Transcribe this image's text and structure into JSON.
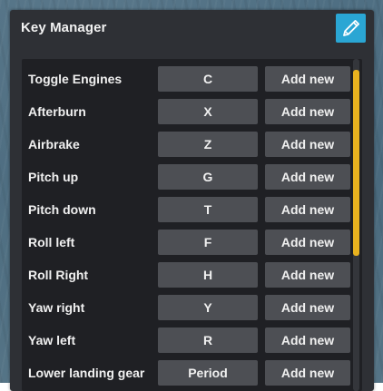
{
  "window": {
    "title": "Key Manager",
    "edit_icon": "pencil-icon",
    "accent_color": "#2aa6d4",
    "scrollbar_color": "#e8b21f"
  },
  "bindings": [
    {
      "action": "Toggle Engines",
      "key": "C",
      "add_label": "Add new"
    },
    {
      "action": "Afterburn",
      "key": "X",
      "add_label": "Add new"
    },
    {
      "action": "Airbrake",
      "key": "Z",
      "add_label": "Add new"
    },
    {
      "action": "Pitch up",
      "key": "G",
      "add_label": "Add new"
    },
    {
      "action": "Pitch down",
      "key": "T",
      "add_label": "Add new"
    },
    {
      "action": "Roll left",
      "key": "F",
      "add_label": "Add new"
    },
    {
      "action": "Roll Right",
      "key": "H",
      "add_label": "Add new"
    },
    {
      "action": "Yaw right",
      "key": "Y",
      "add_label": "Add new"
    },
    {
      "action": "Yaw left",
      "key": "R",
      "add_label": "Add new"
    },
    {
      "action": "Lower landing gear",
      "key": "Period",
      "add_label": "Add new"
    }
  ]
}
